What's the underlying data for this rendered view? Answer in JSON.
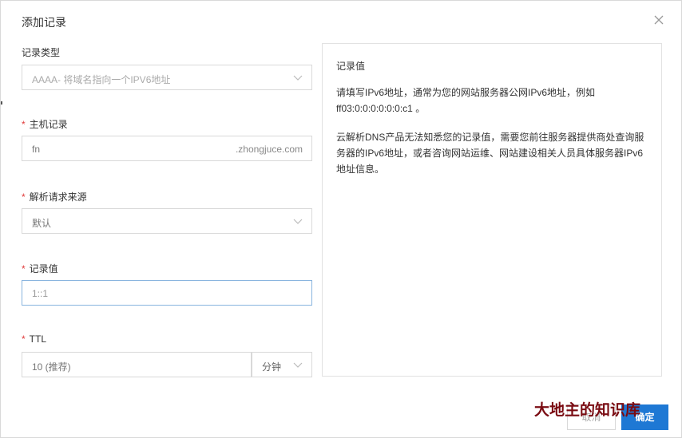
{
  "dialog": {
    "title": "添加记录",
    "close_icon": "close-icon"
  },
  "form": {
    "record_type": {
      "label": "记录类型",
      "value": "AAAA- 将域名指向一个IPV6地址"
    },
    "host": {
      "label": "主机记录",
      "value": "fn",
      "suffix": ".zhongjuce.com"
    },
    "resolve_source": {
      "label": "解析请求来源",
      "value": "默认"
    },
    "record_value": {
      "label": "记录值",
      "value": "1::1"
    },
    "ttl": {
      "label": "TTL",
      "value": "10 (推荐)",
      "unit": "分钟"
    },
    "required_mark": "*"
  },
  "help": {
    "title": "记录值",
    "para1_line1": "请填写IPv6地址，通常为您的网站服务器公网IPv6地址，例如",
    "para1_line2": "ff03:0:0:0:0:0:0:c1 。",
    "para2_line1": "云解析DNS产品无法知悉您的记录值，需要您前往服务器提供商处查询服",
    "para2_line2": "务器的IPv6地址，或者咨询网站运维、网站建设相关人员具体服务器IPv6",
    "para2_line3": "地址信息。"
  },
  "footer": {
    "cancel_label": "取消",
    "ok_label": "确定"
  },
  "watermark": "大地主的知识库",
  "colors": {
    "primary": "#1e78d4",
    "required": "#e03a3a",
    "active_border": "#88b4de",
    "watermark": "#7a0b12"
  }
}
